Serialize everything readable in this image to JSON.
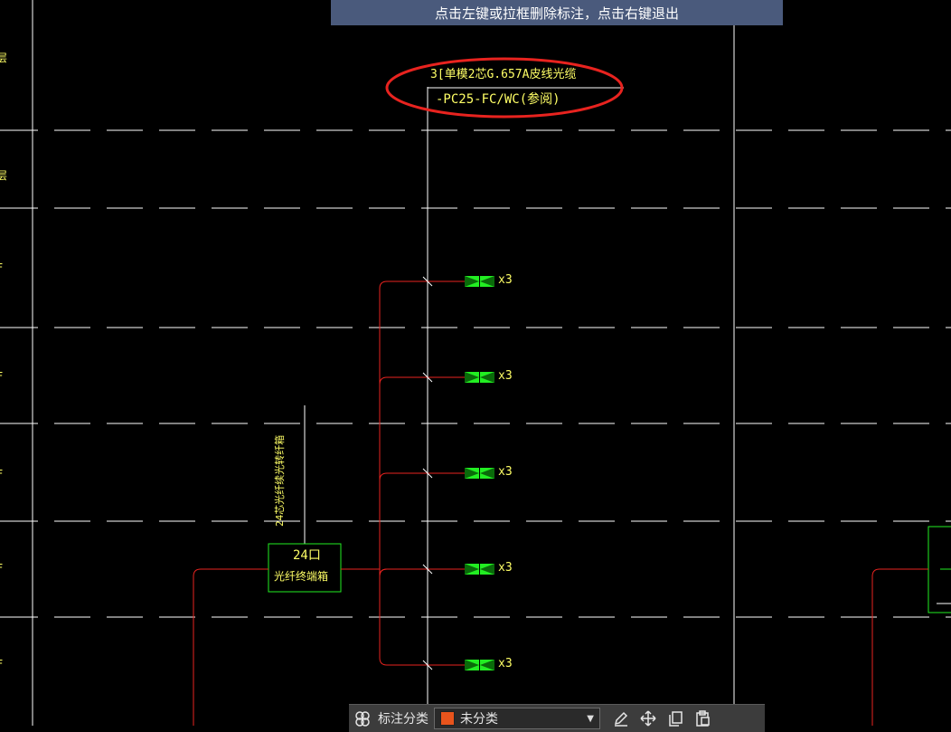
{
  "banner": {
    "message": "点击左键或拉框删除标注，点击右键退出"
  },
  "annotation": {
    "line1": "3[单模2芯G.657A皮线光缆",
    "line2": "-PC25-FC/WC(参阅)",
    "highlight_color": "#e8231f"
  },
  "floor_labels": [
    "层",
    "层",
    "F",
    "F",
    "F",
    "F",
    "F"
  ],
  "outlets": [
    {
      "label": "x3"
    },
    {
      "label": "x3"
    },
    {
      "label": "x3"
    },
    {
      "label": "x3"
    },
    {
      "label": "x3"
    }
  ],
  "panel": {
    "title": "24口",
    "name": "光纤终端箱",
    "vertical_note": "24芯光纤续光转纤箱"
  },
  "toolbar": {
    "category_label": "标注分类",
    "selected_category": "未分类",
    "selected_color": "#e8541c",
    "icons": [
      "layers-icon",
      "edit-icon",
      "move-icon",
      "copy-icon",
      "paste-icon"
    ]
  },
  "colors": {
    "grid": "#ffffff",
    "wire": "#e8231f",
    "device": "#22ee22",
    "text": "#ffff66",
    "background": "#000000"
  }
}
